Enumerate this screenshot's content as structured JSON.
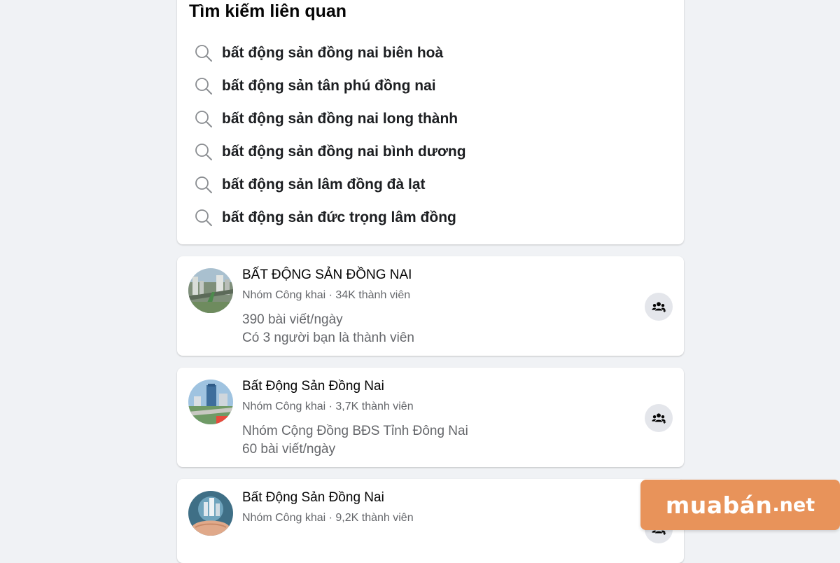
{
  "related": {
    "title": "Tìm kiếm liên quan",
    "suggestions": [
      {
        "label": "bất động sản đồng nai biên hoà",
        "icon": "search-icon"
      },
      {
        "label": "bất động sản tân phú đồng nai",
        "icon": "search-icon"
      },
      {
        "label": "bất động sản đồng nai long thành",
        "icon": "search-icon"
      },
      {
        "label": "bất động sản đồng nai bình dương",
        "icon": "search-icon"
      },
      {
        "label": "bất động sản lâm đồng đà lạt",
        "icon": "search-icon"
      },
      {
        "label": "bất động sản đức trọng lâm đồng",
        "icon": "search-icon"
      }
    ]
  },
  "groups": [
    {
      "name": "BẤT ĐỘNG SẢN ĐỒNG NAI",
      "meta": "Nhóm Công khai · 34K thành viên",
      "lines": [
        "390 bài viết/ngày",
        "Có 3 người bạn là thành viên"
      ],
      "join_icon": "join-group-icon"
    },
    {
      "name": "Bất Động Sản Đồng Nai",
      "meta": "Nhóm Công khai · 3,7K thành viên",
      "lines": [
        "Nhóm Cộng Đồng BĐS Tỉnh Đông Nai",
        "60 bài viết/ngày"
      ],
      "join_icon": "join-group-icon"
    },
    {
      "name": "Bất Động Sản Đồng Nai",
      "meta": "Nhóm Công khai · 9,2K thành viên",
      "lines": [],
      "join_icon": "join-group-icon"
    }
  ],
  "watermark": {
    "main": "muabán",
    "ext": ".net"
  },
  "colors": {
    "background": "#f0f2f5",
    "card": "#ffffff",
    "secondary_text": "#65676b",
    "button_bg": "#e4e6eb",
    "watermark_bg": "#e8935a"
  }
}
